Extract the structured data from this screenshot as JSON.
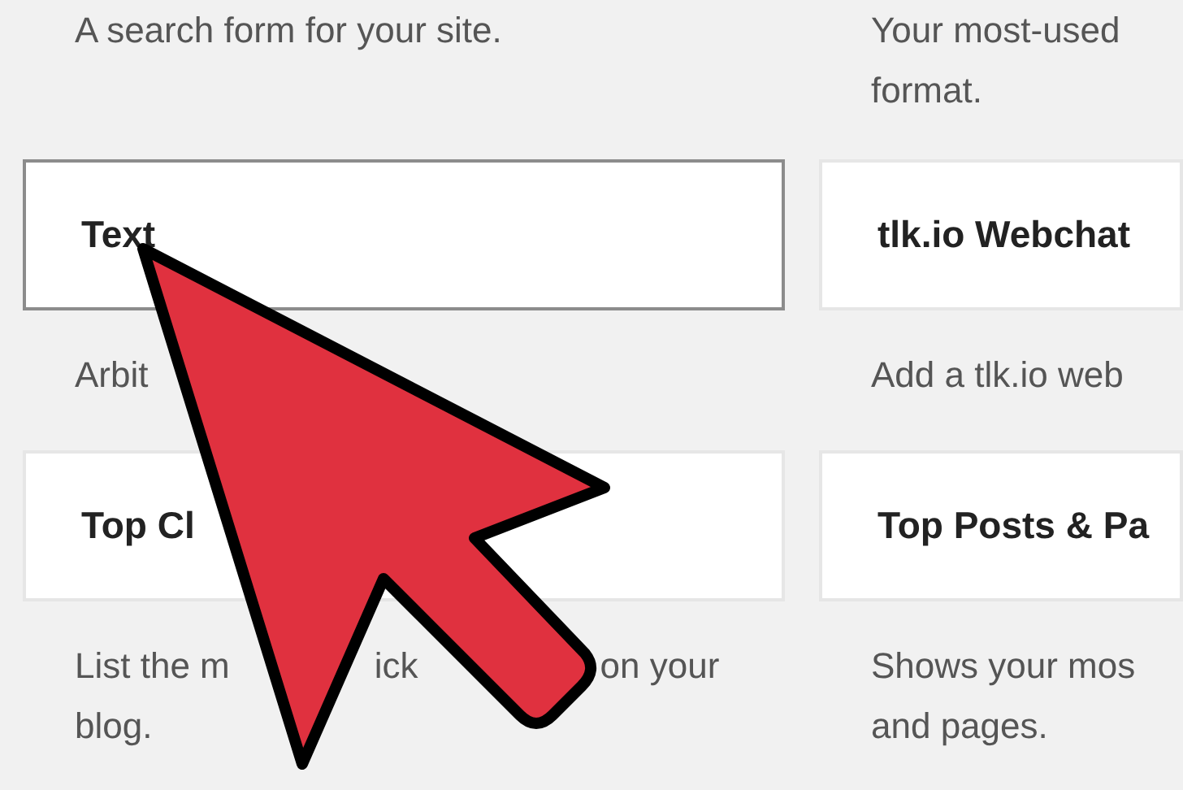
{
  "columns": [
    {
      "top_description": [
        "A search form for your site."
      ],
      "widgets": [
        {
          "title": "Text",
          "hovered": true,
          "description": [
            [
              "Arbit"
            ]
          ]
        },
        {
          "title": "Top Cl",
          "hovered": false,
          "description": [
            [
              "List the m",
              "ick",
              "on your"
            ],
            [
              "blog."
            ]
          ]
        }
      ]
    },
    {
      "top_description": [
        "Your most-used",
        "format."
      ],
      "widgets": [
        {
          "title": "tlk.io Webchat",
          "hovered": false,
          "description": [
            [
              "Add a tlk.io web"
            ]
          ]
        },
        {
          "title": "Top Posts & Pa",
          "hovered": false,
          "description": [
            [
              "Shows your mos"
            ],
            [
              "and pages."
            ]
          ]
        }
      ]
    }
  ]
}
